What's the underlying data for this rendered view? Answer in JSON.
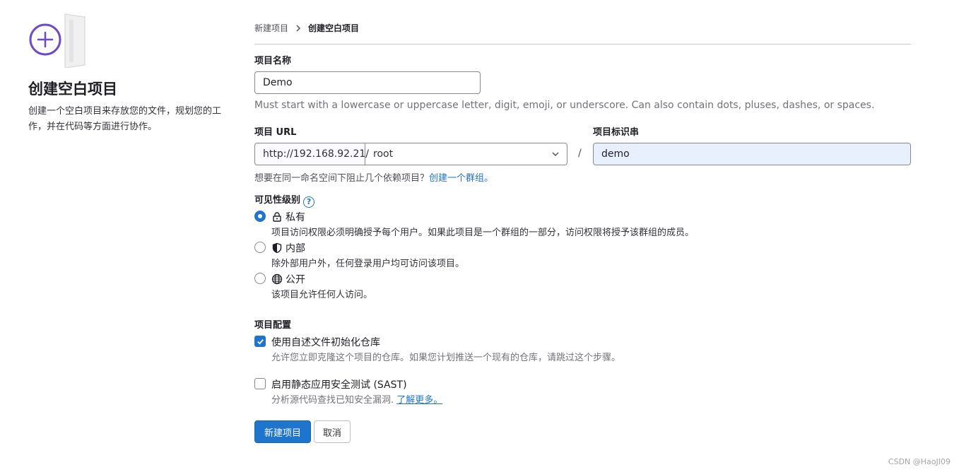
{
  "sidebar": {
    "title": "创建空白项目",
    "description": "创建一个空白项目来存放您的文件，规划您的工作，并在代码等方面进行协作。"
  },
  "breadcrumb": {
    "parent": "新建项目",
    "current": "创建空白项目"
  },
  "form": {
    "project_name": {
      "label": "项目名称",
      "value": "Demo",
      "hint": "Must start with a lowercase or uppercase letter, digit, emoji, or underscore. Can also contain dots, pluses, dashes, or spaces."
    },
    "project_url": {
      "label": "项目 URL",
      "prefix": "http://192.168.92.21/",
      "namespace": "root",
      "separator": "/"
    },
    "project_slug": {
      "label": "项目标识串",
      "value": "demo"
    },
    "group_hint": {
      "text": "想要在同一命名空间下阻止几个依赖项目？",
      "link": "创建一个群组。"
    },
    "visibility": {
      "label": "可见性级别",
      "help_icon": "question-circle-icon",
      "options": [
        {
          "title": "私有",
          "icon": "lock-icon",
          "description": "项目访问权限必须明确授予每个用户。如果此项目是一个群组的一部分，访问权限将授予该群组的成员。",
          "selected": true
        },
        {
          "title": "内部",
          "icon": "shield-icon",
          "description": "除外部用户外，任何登录用户均可访问该项目。",
          "selected": false
        },
        {
          "title": "公开",
          "icon": "globe-icon",
          "description": "该项目允许任何人访问。",
          "selected": false
        }
      ]
    },
    "config": {
      "label": "项目配置",
      "readme": {
        "label": "使用自述文件初始化仓库",
        "description": "允许您立即克隆这个项目的仓库。如果您计划推送一个现有的仓库，请跳过这个步骤。",
        "checked": true
      },
      "sast": {
        "label": "启用静态应用安全测试 (SAST)",
        "description": "分析源代码查找已知安全漏洞.",
        "link": "了解更多。",
        "checked": false
      }
    },
    "submit_label": "新建项目",
    "cancel_label": "取消"
  },
  "watermark": "CSDN @HaoJI09",
  "colors": {
    "primary": "#1f75cb",
    "illustration_purple": "#6e49cb"
  }
}
